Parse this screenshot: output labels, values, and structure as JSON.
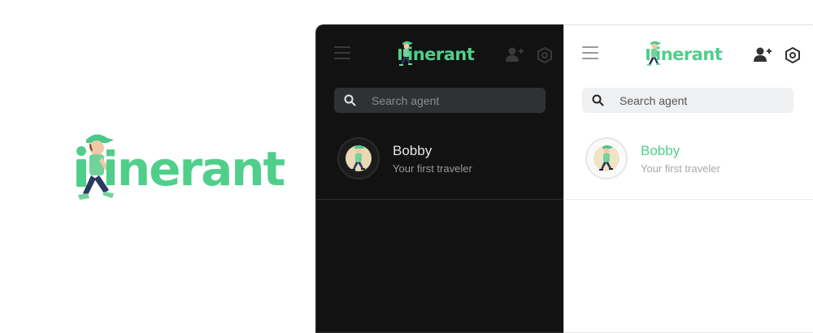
{
  "brand": {
    "name_suffix": "inerant",
    "accent": "#4fcf8a",
    "cap_color": "#48c98a",
    "shirt_color": "#6fd39a",
    "pants_color": "#283a60",
    "skin_color": "#f1c9a5"
  },
  "dark_panel": {
    "search": {
      "placeholder": "Search agent"
    },
    "agent": {
      "name": "Bobby",
      "subtitle": "Your first traveler"
    },
    "icons": {
      "menu": "hamburger-menu-icon",
      "add_user": "add-user-icon",
      "settings": "settings-hexagon-icon",
      "search": "search-icon"
    }
  },
  "light_panel": {
    "search": {
      "placeholder": "Search agent"
    },
    "agent": {
      "name": "Bobby",
      "subtitle": "Your first traveler"
    },
    "icons": {
      "menu": "hamburger-menu-icon",
      "add_user": "add-user-icon",
      "settings": "settings-hexagon-icon",
      "search": "search-icon"
    }
  }
}
